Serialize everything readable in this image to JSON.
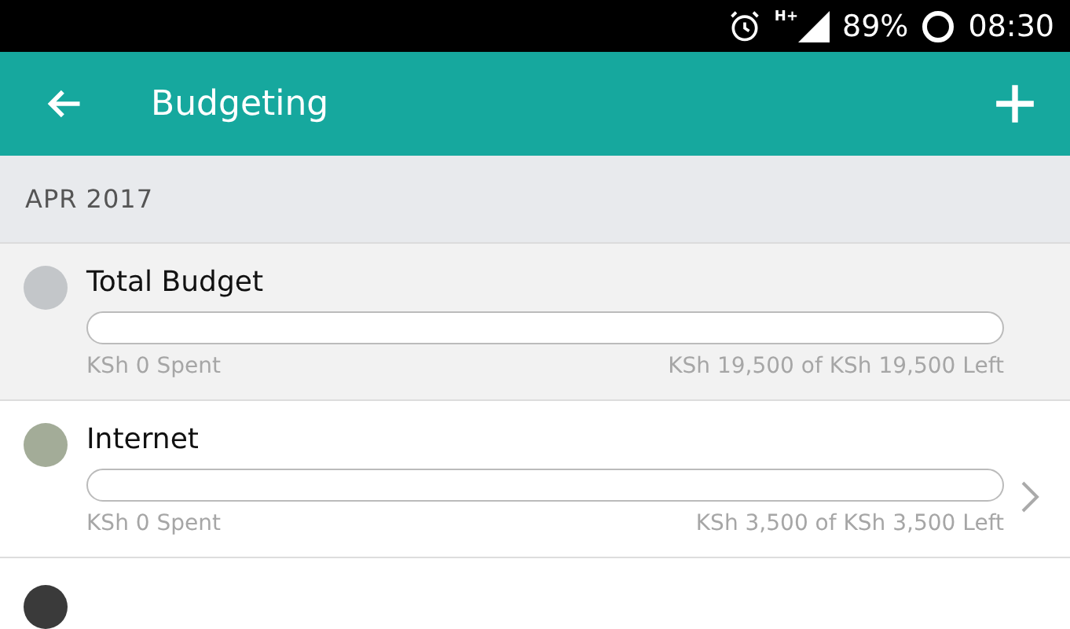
{
  "status_bar": {
    "network": "H+",
    "battery": "89%",
    "time": "08:30"
  },
  "app_bar": {
    "title": "Budgeting"
  },
  "section": {
    "title": "APR 2017"
  },
  "budgets": [
    {
      "name": "Total Budget",
      "color": "#c3c6c9",
      "level": 0,
      "spent": "KSh 0 Spent",
      "left": "KSh 19,500 of KSh 19,500 Left",
      "selected": true,
      "chevron": false
    },
    {
      "name": "Internet",
      "color": "#a3ac98",
      "level": 0,
      "spent": "KSh 0 Spent",
      "left": "KSh 3,500 of KSh 3,500 Left",
      "selected": false,
      "chevron": true
    }
  ],
  "peek_row": {
    "color": "#3a3a3a"
  }
}
